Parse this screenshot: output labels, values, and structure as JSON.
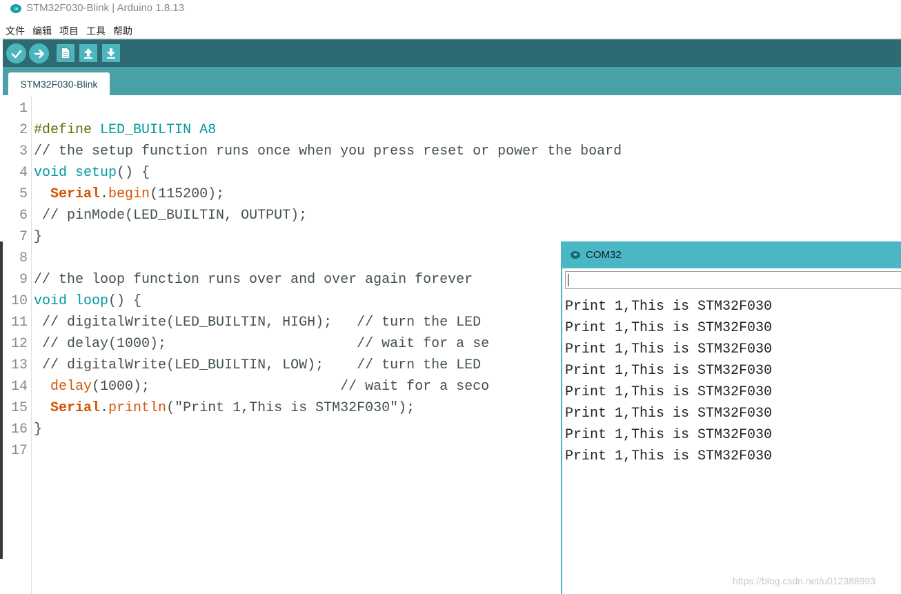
{
  "window": {
    "title": "STM32F030-Blink | Arduino 1.8.13",
    "icon": "arduino-logo-icon"
  },
  "menu": {
    "items": [
      "文件",
      "编辑",
      "项目",
      "工具",
      "帮助"
    ]
  },
  "toolbar": {
    "buttons": [
      "verify-icon",
      "upload-icon",
      "new-icon",
      "open-icon",
      "save-icon"
    ],
    "accent": "#4cb6bf",
    "background": "#2d6a72"
  },
  "tabs": [
    {
      "label": "STM32F030-Blink",
      "active": true
    }
  ],
  "editor": {
    "line_numbers": [
      "1",
      "2",
      "3",
      "4",
      "5",
      "6",
      "7",
      "8",
      "9",
      "10",
      "11",
      "12",
      "13",
      "14",
      "15",
      "16",
      "17"
    ],
    "lines": [
      "",
      "#define LED_BUILTIN A8",
      "// the setup function runs once when you press reset or power the board",
      "void setup() {",
      "  Serial.begin(115200);",
      " // pinMode(LED_BUILTIN, OUTPUT);",
      "}",
      "",
      "// the loop function runs over and over again forever",
      "void loop() {",
      " // digitalWrite(LED_BUILTIN, HIGH);   // turn the LED",
      " // delay(1000);                       // wait for a se",
      " // digitalWrite(LED_BUILTIN, LOW);    // turn the LED",
      "  delay(1000);                       // wait for a seco",
      "  Serial.println(\"Print 1,This is STM32F030\");",
      "}",
      ""
    ]
  },
  "serial_monitor": {
    "title": "COM32",
    "input_value": "",
    "output": [
      "Print 1,This is STM32F030",
      "Print 1,This is STM32F030",
      "Print 1,This is STM32F030",
      "Print 1,This is STM32F030",
      "Print 1,This is STM32F030",
      "Print 1,This is STM32F030",
      "Print 1,This is STM32F030",
      "Print 1,This is STM32F030"
    ]
  },
  "watermark": "https://blog.csdn.net/u012388993"
}
